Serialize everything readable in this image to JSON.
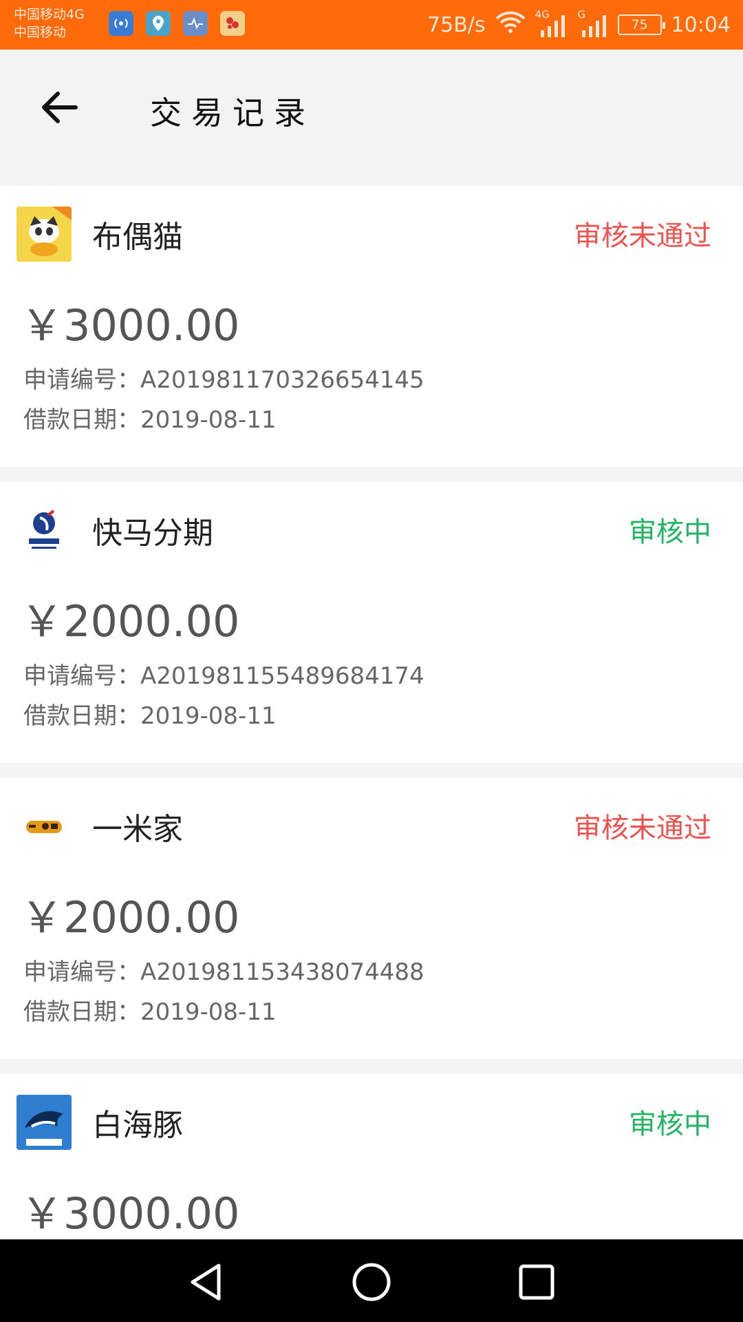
{
  "status_bar": {
    "carrier_1": "中国移动4G",
    "carrier_2": "中国移动",
    "speed": "75B/s",
    "net_1": "4G",
    "net_2": "G",
    "battery": "75",
    "time": "10:04",
    "accent": "#ff6a0a"
  },
  "header": {
    "back_icon": "arrow-left-icon",
    "title": "交易记录"
  },
  "records": [
    {
      "app_name": "布偶猫",
      "status": "审核未通过",
      "status_type": "rejected",
      "amount": "￥3000.00",
      "apply_no_label": "申请编号：",
      "apply_no": "A201981170326654145",
      "date_label": "借款日期：",
      "date": "2019-08-11"
    },
    {
      "app_name": "快马分期",
      "status": "审核中",
      "status_type": "pending",
      "amount": "￥2000.00",
      "apply_no_label": "申请编号：",
      "apply_no": "A201981155489684174",
      "date_label": "借款日期：",
      "date": "2019-08-11"
    },
    {
      "app_name": "一米家",
      "status": "审核未通过",
      "status_type": "rejected",
      "amount": "￥2000.00",
      "apply_no_label": "申请编号：",
      "apply_no": "A201981153438074488",
      "date_label": "借款日期：",
      "date": "2019-08-11"
    },
    {
      "app_name": "白海豚",
      "status": "审核中",
      "status_type": "pending",
      "amount": "￥3000.00"
    }
  ],
  "colors": {
    "rejected": "#ef5350",
    "pending": "#22b563"
  },
  "nav": {
    "back_icon": "triangle-back-icon",
    "home_icon": "circle-home-icon",
    "recents_icon": "square-recents-icon"
  }
}
